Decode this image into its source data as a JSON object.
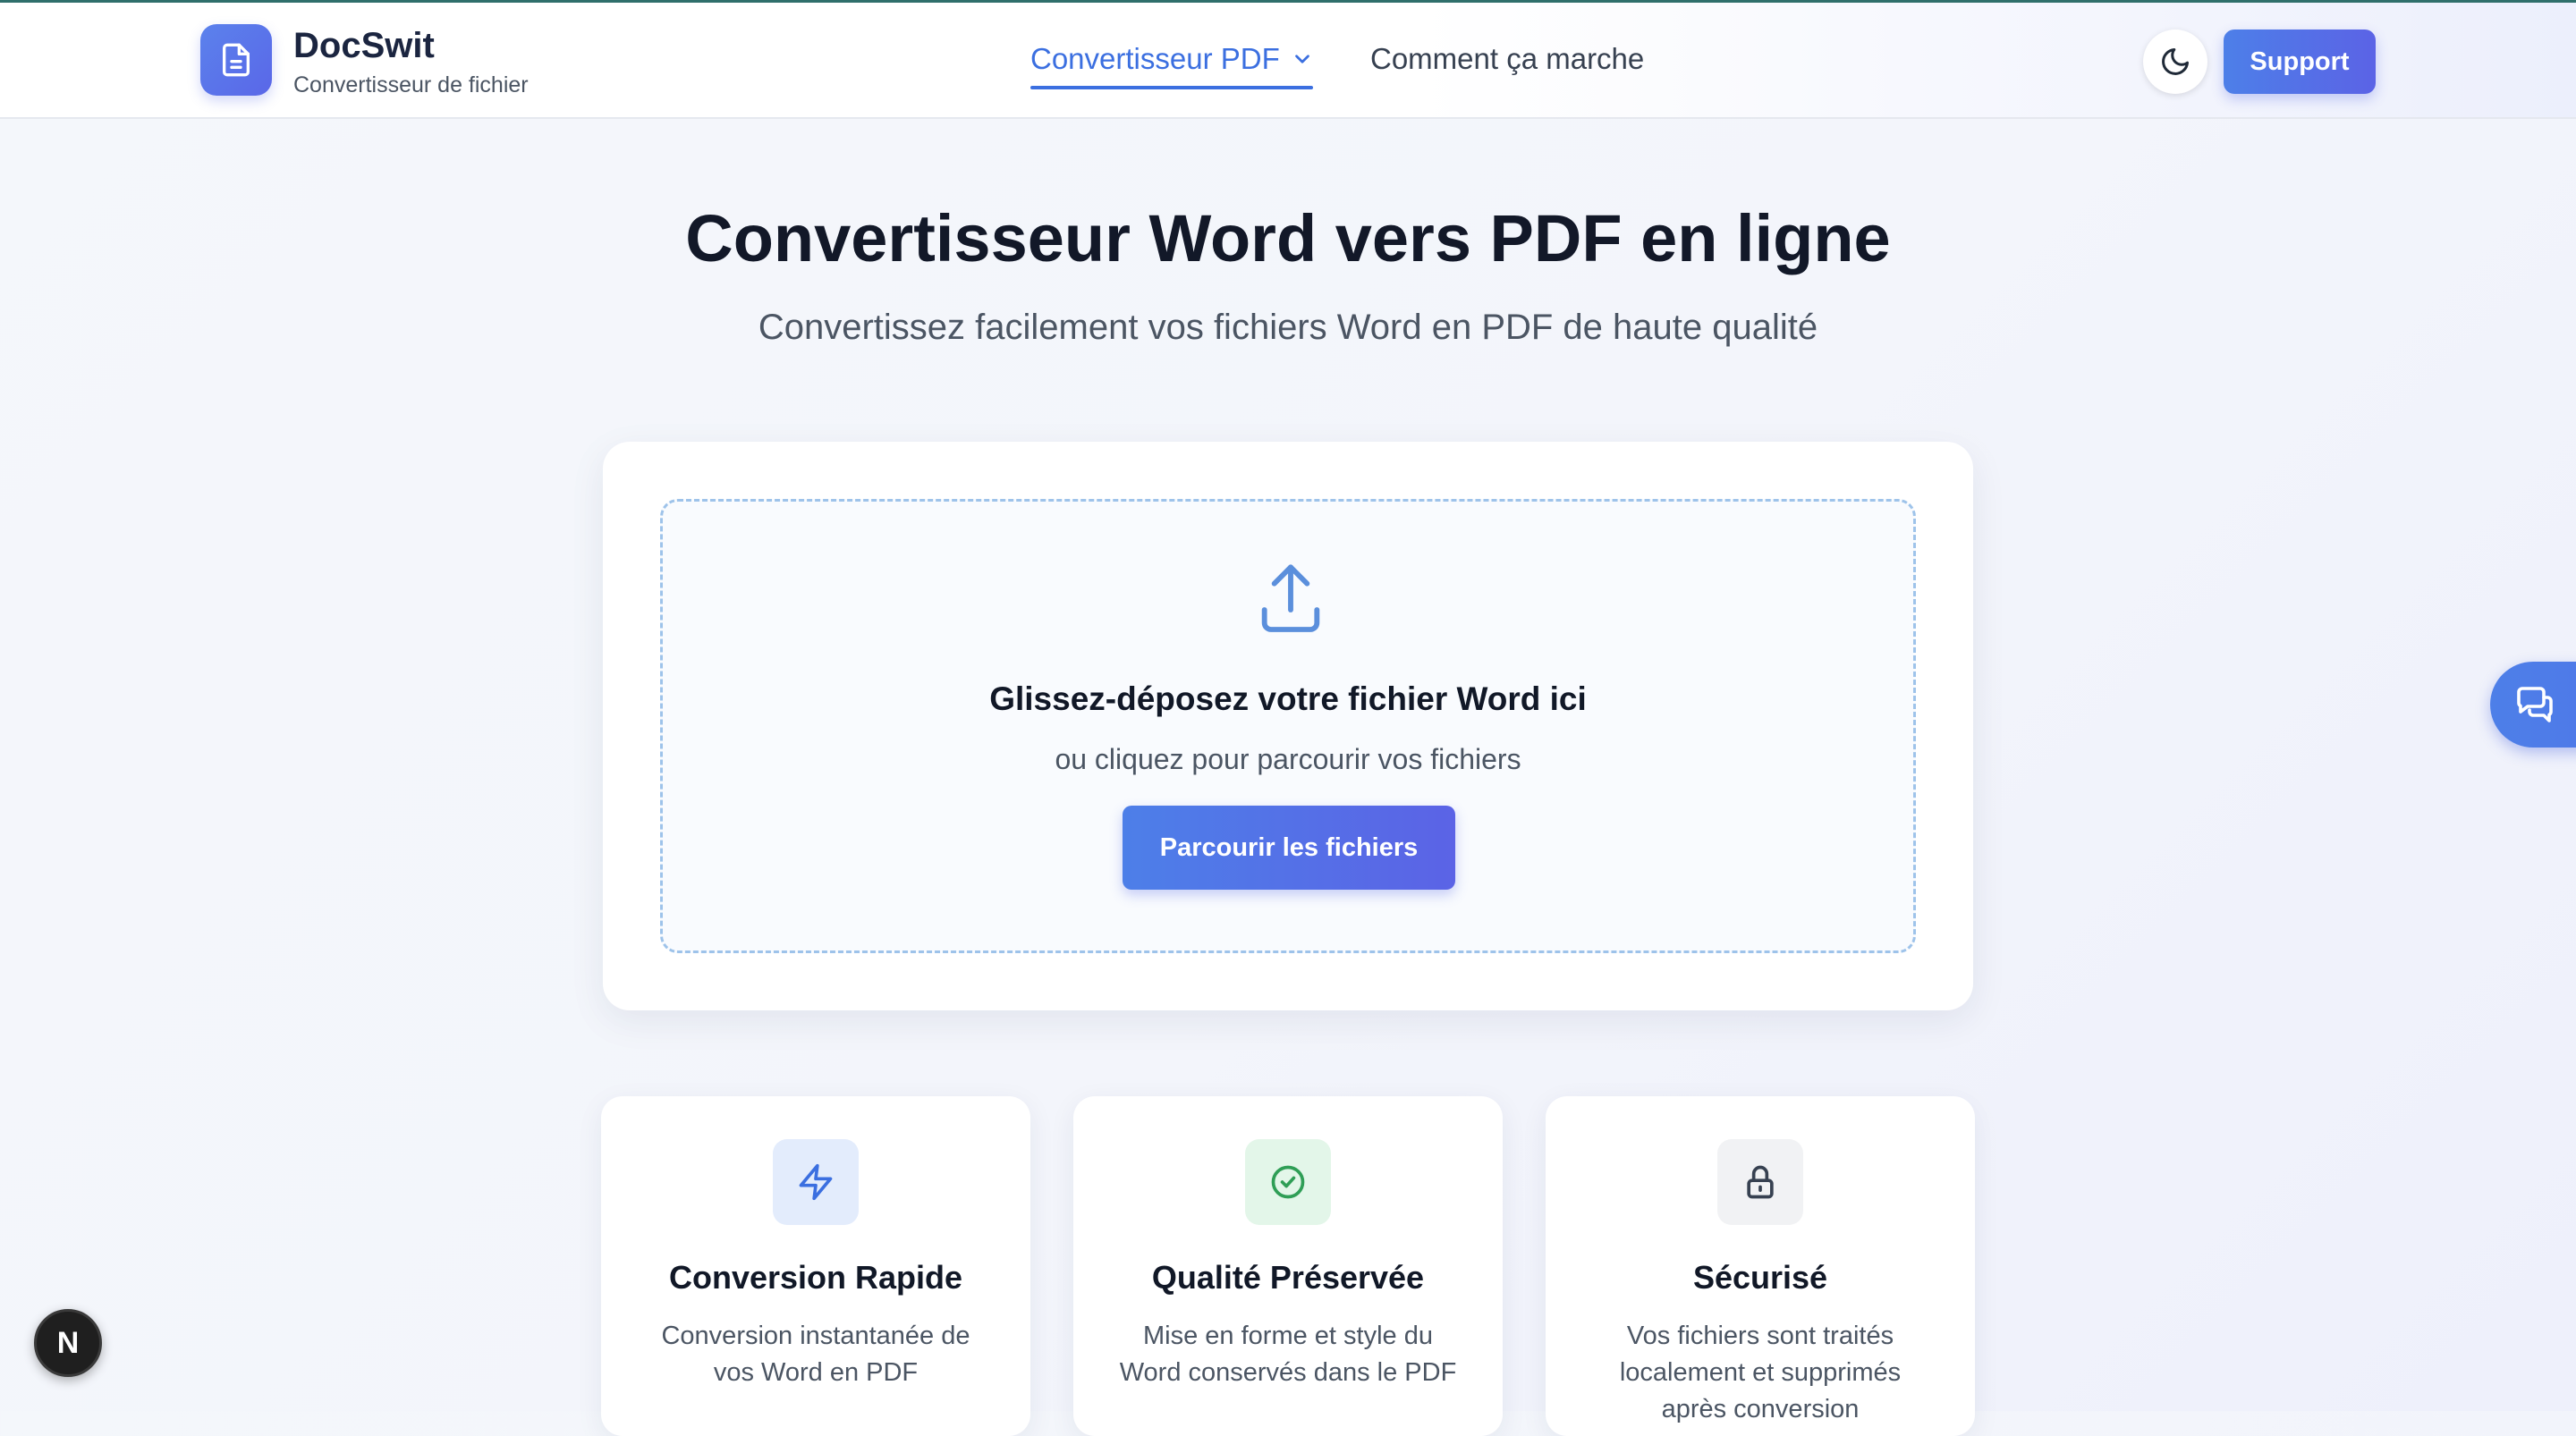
{
  "header": {
    "brand_name": "DocSwit",
    "brand_subtitle": "Convertisseur de fichier",
    "nav": {
      "pdf_converter": "Convertisseur PDF",
      "how_it_works": "Comment ça marche"
    },
    "support_label": "Support"
  },
  "hero": {
    "title": "Convertisseur Word vers PDF en ligne",
    "subtitle": "Convertissez facilement vos fichiers Word en PDF de haute qualité"
  },
  "upload": {
    "drop_title": "Glissez-déposez votre fichier Word ici",
    "drop_subtitle": "ou cliquez pour parcourir vos fichiers",
    "browse_label": "Parcourir les fichiers"
  },
  "features": [
    {
      "icon": "lightning-icon",
      "title": "Conversion Rapide",
      "description": "Conversion instantanée de vos Word en PDF"
    },
    {
      "icon": "check-circle-icon",
      "title": "Qualité Préservée",
      "description": "Mise en forme et style du Word conservés dans le PDF"
    },
    {
      "icon": "lock-icon",
      "title": "Sécurisé",
      "description": "Vos fichiers sont traités localement et supprimés après conversion"
    }
  ],
  "floating": {
    "next_badge": "N"
  },
  "colors": {
    "accent": "#4d7fe8",
    "accent_end": "#5b63e6",
    "nav_active": "#3b6fe0",
    "feature_blue_bg": "#e3ecfc",
    "feature_green_bg": "#e3f6e9",
    "feature_gray_bg": "#f1f2f4"
  }
}
